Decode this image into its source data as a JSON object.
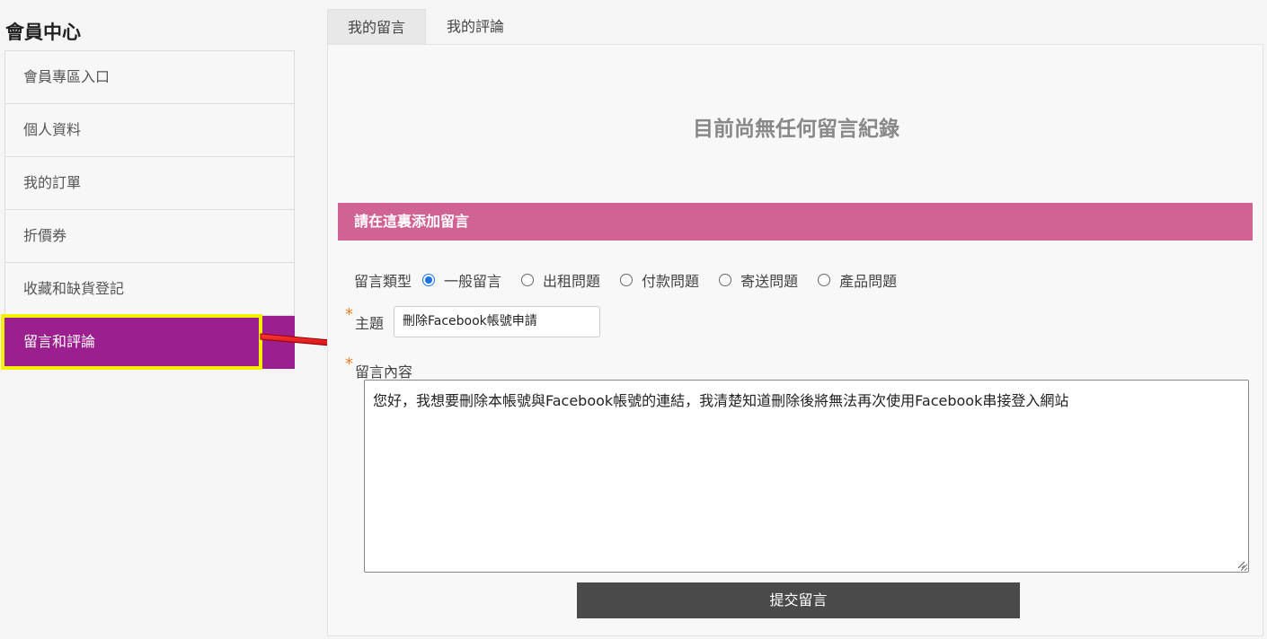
{
  "sidebar": {
    "title": "會員中心",
    "items": [
      {
        "label": "會員專區入口"
      },
      {
        "label": "個人資料"
      },
      {
        "label": "我的訂單"
      },
      {
        "label": "折價券"
      },
      {
        "label": "收藏和缺貨登記"
      },
      {
        "label": "留言和評論",
        "active": true
      }
    ]
  },
  "tabs": [
    {
      "label": "我的留言",
      "active": true
    },
    {
      "label": "我的評論"
    }
  ],
  "main": {
    "empty_message": "目前尚無任何留言紀錄",
    "section_title": "請在這裏添加留言",
    "type_label": "留言類型",
    "type_options": [
      {
        "label": "一般留言",
        "checked": true
      },
      {
        "label": "出租問題"
      },
      {
        "label": "付款問題"
      },
      {
        "label": "寄送問題"
      },
      {
        "label": "產品問題"
      }
    ],
    "required_mark": "*",
    "subject_label": "主題",
    "subject_value": "刪除Facebook帳號申請",
    "content_label": "留言內容",
    "content_value": "您好，我想要刪除本帳號與Facebook帳號的連結，我清楚知道刪除後將無法再次使用Facebook串接登入網站",
    "submit_label": "提交留言"
  },
  "colors": {
    "active_menu": "#9b1f8f",
    "section_bar": "#d06294",
    "highlight": "#f5f000",
    "arrow": "#e01010",
    "submit": "#4a4a4a"
  }
}
